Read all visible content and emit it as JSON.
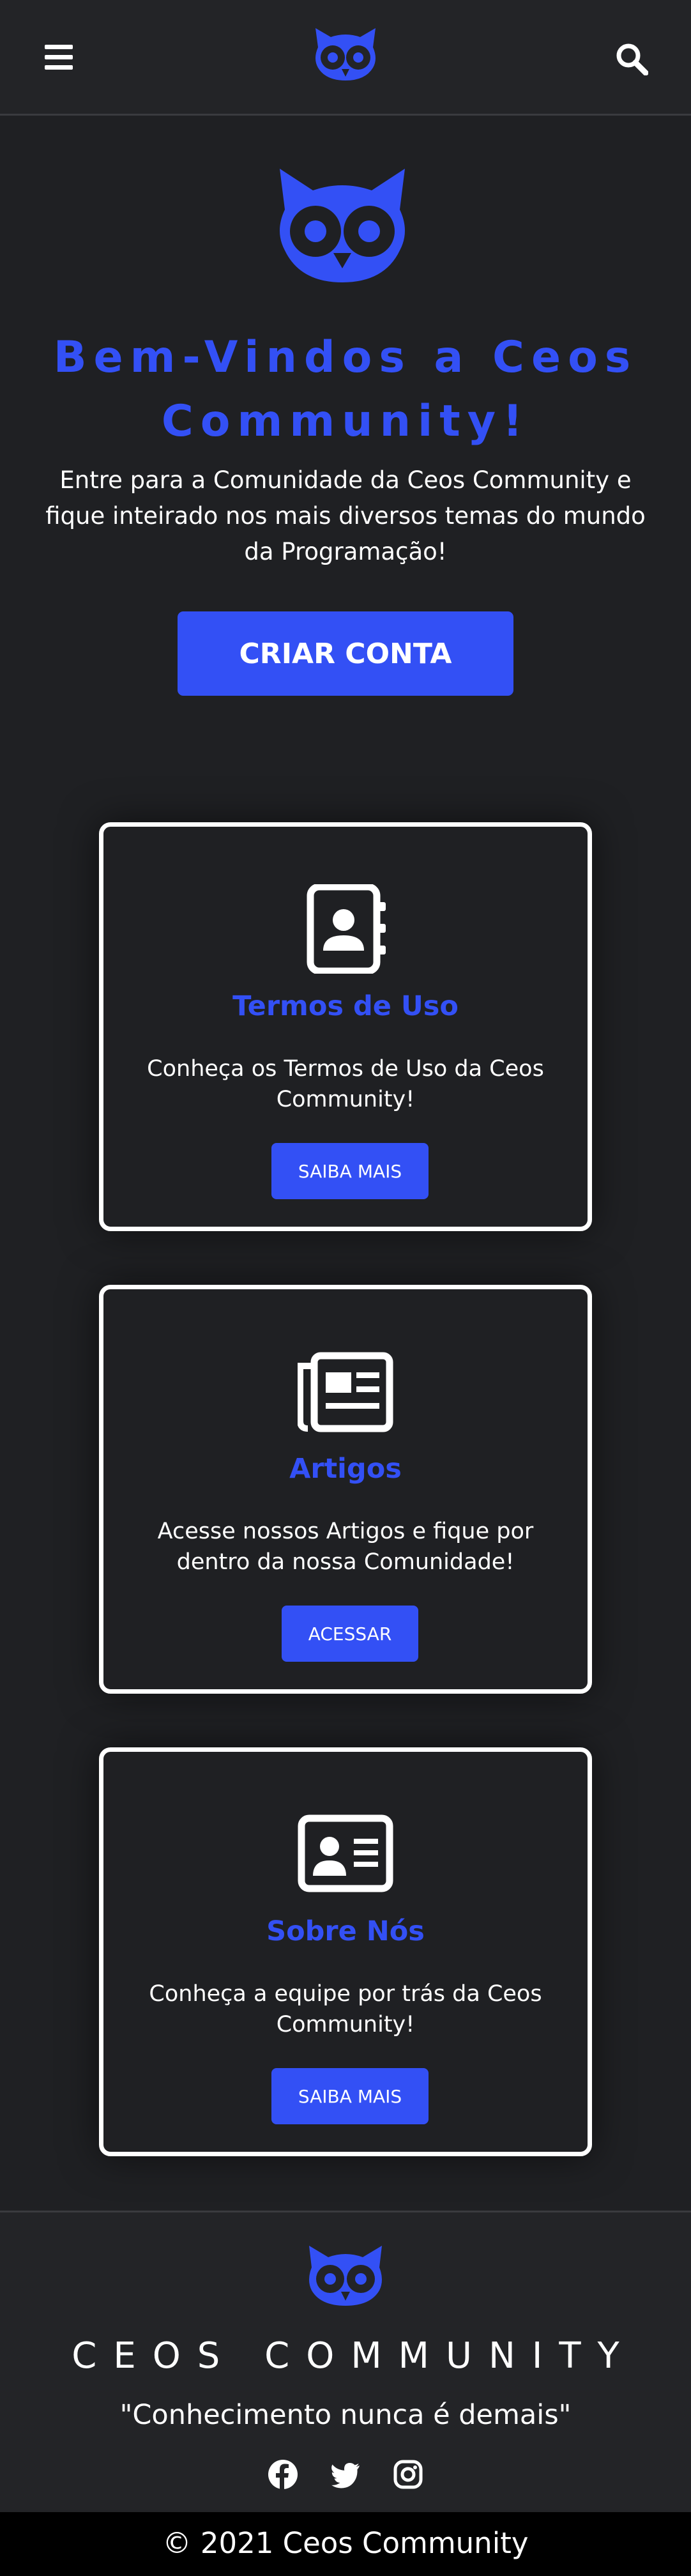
{
  "colors": {
    "accent": "#3350f5",
    "background": "#1f2023",
    "header_bg": "#232427",
    "text": "#ffffff"
  },
  "header": {
    "menu_icon": "hamburger-menu-icon",
    "logo_icon": "owl-logo-icon",
    "search_icon": "search-icon"
  },
  "hero": {
    "title": "Bem-Vindos a Ceos Community!",
    "subtitle": "Entre para a Comunidade da Ceos Community e fique inteirado nos mais diversos temas do mundo da Programação!",
    "cta_label": "CRIAR CONTA"
  },
  "cards": [
    {
      "icon": "address-book-icon",
      "title": "Termos de Uso",
      "text": "Conheça os Termos de Uso da Ceos Community!",
      "button": "SAIBA MAIS"
    },
    {
      "icon": "newspaper-icon",
      "title": "Artigos",
      "text": "Acesse nossos Artigos e fique por dentro da nossa Comunidade!",
      "button": "ACESSAR"
    },
    {
      "icon": "id-card-icon",
      "title": "Sobre Nós",
      "text": "Conheça a equipe por trás da Ceos Community!",
      "button": "SAIBA MAIS"
    }
  ],
  "footer": {
    "brand": "CEOS COMMUNITY",
    "slogan": "\"Conhecimento nunca é demais\"",
    "social": [
      "facebook-icon",
      "twitter-icon",
      "instagram-icon"
    ],
    "copyright": "© 2021 Ceos Community"
  }
}
